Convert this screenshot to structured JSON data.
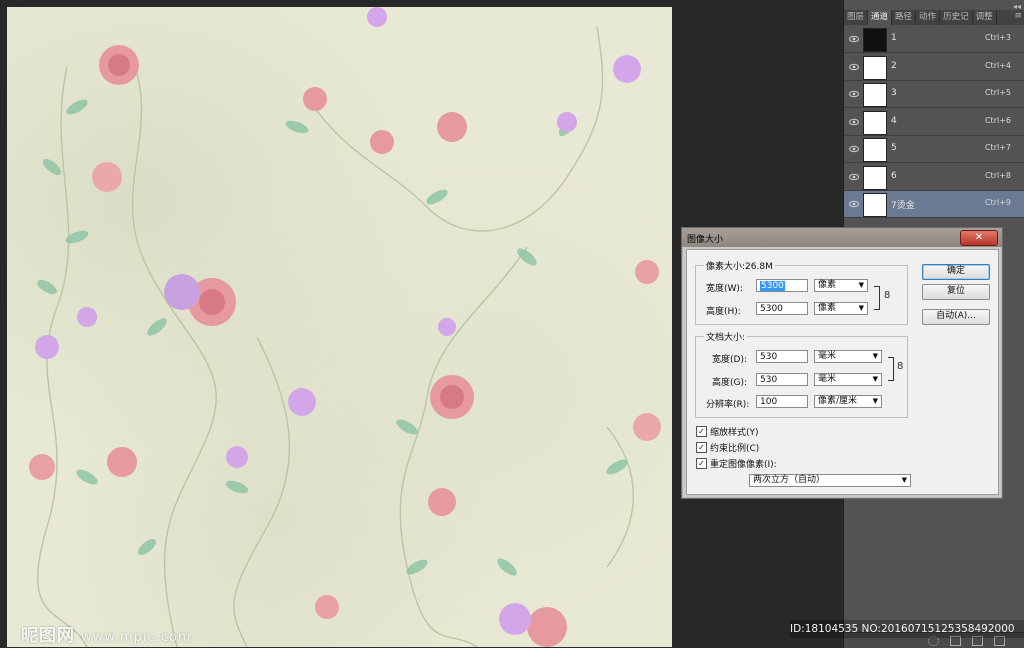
{
  "panel": {
    "collapse_glyph": "◂◂",
    "tabs": [
      "图层",
      "通道",
      "路径",
      "动作",
      "历史记",
      "调整"
    ],
    "active_tab_index": 1,
    "menu_glyph": "≡",
    "channels": [
      {
        "name": "1",
        "shortcut": "Ctrl+3",
        "thumb": "dark",
        "selected": false
      },
      {
        "name": "2",
        "shortcut": "Ctrl+4",
        "thumb": "light",
        "selected": false
      },
      {
        "name": "3",
        "shortcut": "Ctrl+5",
        "thumb": "light",
        "selected": false
      },
      {
        "name": "4",
        "shortcut": "Ctrl+6",
        "thumb": "light",
        "selected": false
      },
      {
        "name": "5",
        "shortcut": "Ctrl+7",
        "thumb": "light",
        "selected": false
      },
      {
        "name": "6",
        "shortcut": "Ctrl+8",
        "thumb": "light",
        "selected": false
      },
      {
        "name": "7烫金",
        "shortcut": "Ctrl+9",
        "thumb": "light",
        "selected": true
      }
    ]
  },
  "dialog": {
    "title": "图像大小",
    "close_glyph": "✕",
    "pixel_group": {
      "title": "像素大小:26.8M",
      "width_label": "宽度(W):",
      "width_value": "5300",
      "width_unit": "像素",
      "height_label": "高度(H):",
      "height_value": "5300",
      "height_unit": "像素"
    },
    "doc_group": {
      "title": "文档大小:",
      "width_label": "宽度(D):",
      "width_value": "530",
      "width_unit": "毫米",
      "height_label": "高度(G):",
      "height_value": "530",
      "height_unit": "毫米",
      "res_label": "分辨率(R):",
      "res_value": "100",
      "res_unit": "像素/厘米"
    },
    "buttons": {
      "ok": "确定",
      "reset": "复位",
      "auto": "自动(A)..."
    },
    "checkboxes": [
      {
        "label": "缩放样式(Y)",
        "checked": true
      },
      {
        "label": "约束比例(C)",
        "checked": true
      },
      {
        "label": "重定图像像素(I):",
        "checked": true
      }
    ],
    "resample_method": "两次立方（自动）",
    "link_glyph": "8"
  },
  "watermark": {
    "brand": "昵图网",
    "url": "www.nipic.com"
  },
  "id_strip": "ID:18104535 NO:20160715125358492000",
  "colors": {
    "canvas_bg": "#e8e9d4",
    "panel_bg": "#535353",
    "selected_row": "#6b7a92",
    "selection": "#3399ff"
  }
}
